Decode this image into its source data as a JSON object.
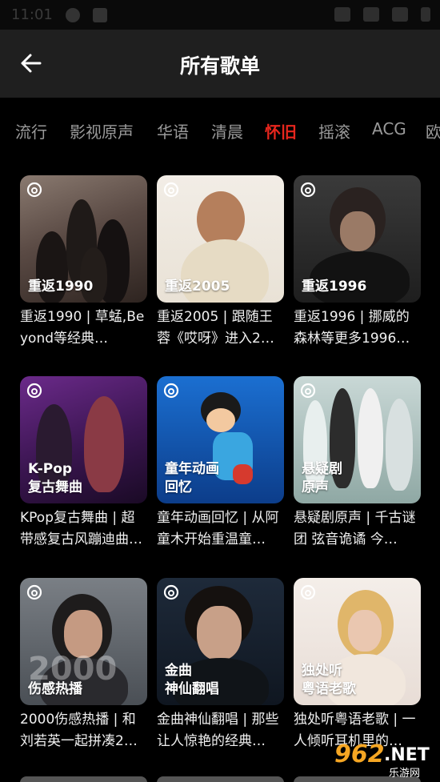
{
  "status_bar": {
    "time": "11:01"
  },
  "header": {
    "title": "所有歌单"
  },
  "tabs": [
    {
      "label": "流行"
    },
    {
      "label": "影视原声"
    },
    {
      "label": "华语"
    },
    {
      "label": "清晨"
    },
    {
      "label": "怀旧",
      "active": true
    },
    {
      "label": "摇滚"
    },
    {
      "label": "ACG"
    },
    {
      "label": "欧"
    }
  ],
  "accent_color": "#e8261d",
  "playlists": [
    {
      "cover_line1": "重返1990",
      "cover_line2": "",
      "title": "重返1990 | 草蜢,Beyond等经典…"
    },
    {
      "cover_line1": "重返2005",
      "cover_line2": "",
      "title": "重返2005 | 跟随王蓉《哎呀》进入2…"
    },
    {
      "cover_line1": "重返1996",
      "cover_line2": "",
      "title": "重返1996 | 挪威的森林等更多1996…"
    },
    {
      "cover_line1": "K-Pop",
      "cover_line2": "复古舞曲",
      "title": "KPop复古舞曲 | 超带感复古风蹦迪曲…"
    },
    {
      "cover_line1": "童年动画",
      "cover_line2": "回忆",
      "title": "童年动画回忆 | 从阿童木开始重温童…"
    },
    {
      "cover_line1": "悬疑剧",
      "cover_line2": "原声",
      "title": "悬疑剧原声 | 千古谜团 弦音诡谲 今…"
    },
    {
      "cover_line1": "伤感热播",
      "cover_line2": "",
      "cover_big": "2000",
      "title": "2000伤感热播 | 和刘若英一起拼凑2…"
    },
    {
      "cover_line1": "金曲",
      "cover_line2": "神仙翻唱",
      "title": "金曲神仙翻唱 | 那些让人惊艳的经典…"
    },
    {
      "cover_line1": "独处听",
      "cover_line2": "粤语老歌",
      "title": "独处听粤语老歌 | 一人倾听耳机里的…"
    }
  ],
  "watermark": {
    "number": "962",
    "suffix": ".NET",
    "sub": "乐游网"
  }
}
